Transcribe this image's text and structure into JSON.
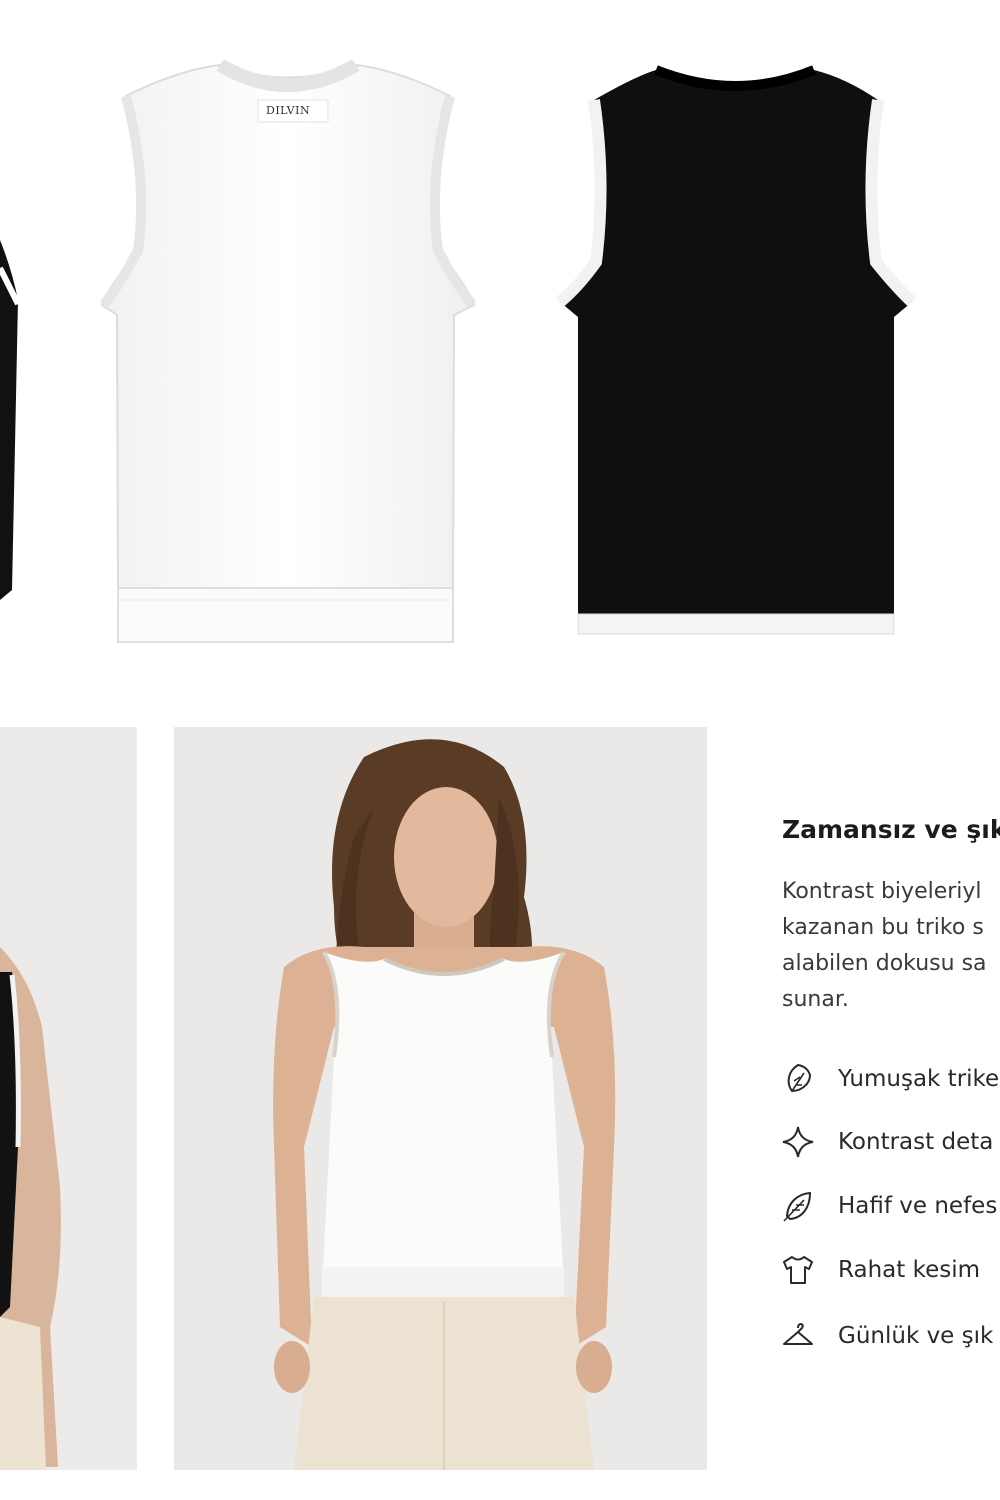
{
  "brand_label": "DILVIN",
  "heading": "Zamansız ve şık",
  "description_lines": [
    "Kontrast biyeleriyl",
    "kazanan bu triko s",
    "alabilen dokusu sa",
    "sunar."
  ],
  "features": [
    {
      "icon": "leaf-icon",
      "label": "Yumuşak trike"
    },
    {
      "icon": "sparkle-icon",
      "label": "Kontrast deta"
    },
    {
      "icon": "feather-icon",
      "label": "Hafif ve nefes"
    },
    {
      "icon": "tshirt-icon",
      "label": "Rahat kesim"
    },
    {
      "icon": "hanger-icon",
      "label": "Günlük ve şık"
    }
  ]
}
